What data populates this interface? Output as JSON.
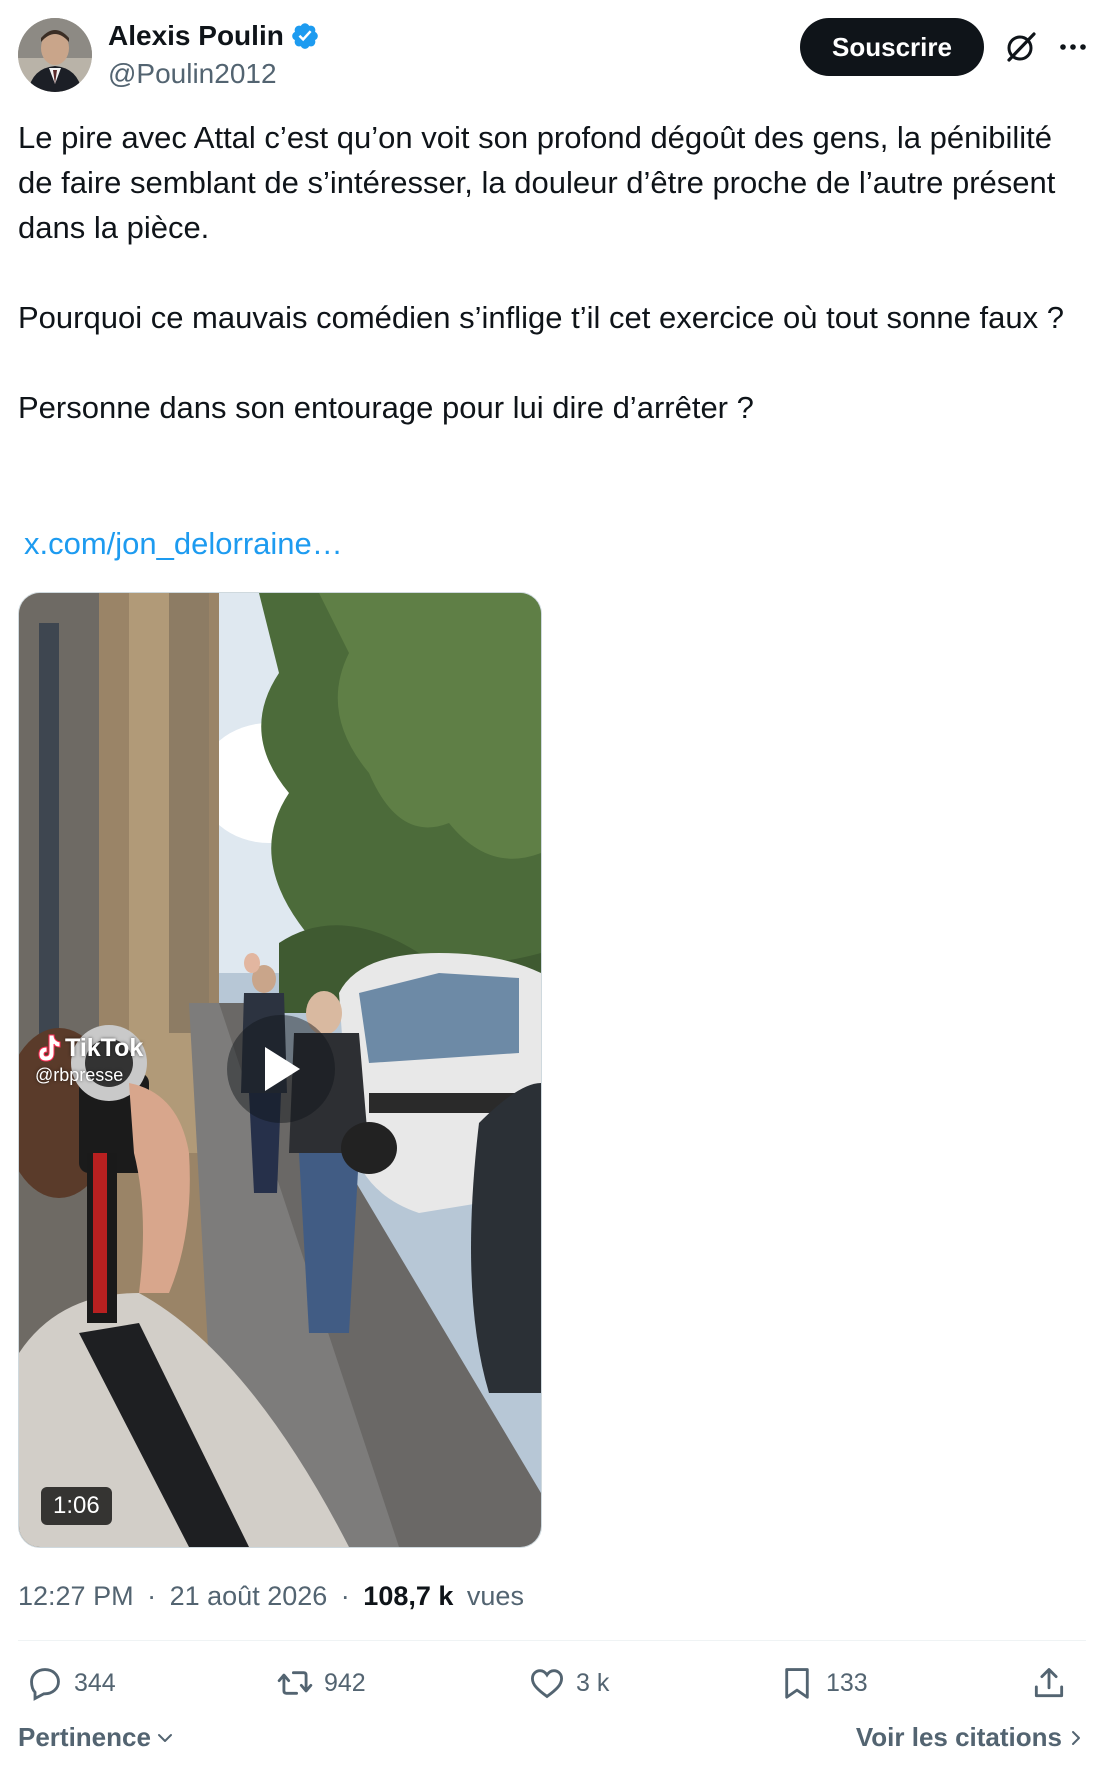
{
  "author": {
    "display_name": "Alexis Poulin",
    "handle": "@Poulin2012",
    "verified": true
  },
  "header": {
    "subscribe_label": "Souscrire"
  },
  "tweet": {
    "paragraphs": [
      "Le pire avec Attal c’est qu’on voit son profond dégoût des gens, la pénibilité de faire semblant de s’intéresser, la douleur d’être proche de l’autre présent dans la pièce.",
      "Pourquoi ce mauvais comédien s’inflige t’il cet exercice où tout sonne faux ?",
      "Personne dans son entourage pour lui dire d’arrêter ?"
    ],
    "link": "x.com/jon_delorraine…"
  },
  "video": {
    "watermark_brand": "TikTok",
    "watermark_user": "@rbpresse",
    "duration": "1:06"
  },
  "meta": {
    "time": "12:27 PM",
    "separator": "·",
    "date": "21 août 2026",
    "views_count": "108,7 k",
    "views_label": "vues"
  },
  "actions": {
    "replies": "344",
    "reposts": "942",
    "likes": "3 k",
    "bookmarks": "133"
  },
  "footer": {
    "sort_label": "Pertinence",
    "quotes_label": "Voir les citations"
  },
  "colors": {
    "text_primary": "#0f1419",
    "text_secondary": "#536471",
    "link": "#1d9bf0",
    "verified": "#1d9bf0",
    "button_bg": "#0f1419"
  },
  "icons": [
    "verified-badge-icon",
    "grok-icon",
    "more-icon",
    "tiktok-icon",
    "play-icon",
    "reply-icon",
    "repost-icon",
    "like-icon",
    "bookmark-icon",
    "share-icon",
    "chevron-down-icon",
    "chevron-right-icon"
  ]
}
